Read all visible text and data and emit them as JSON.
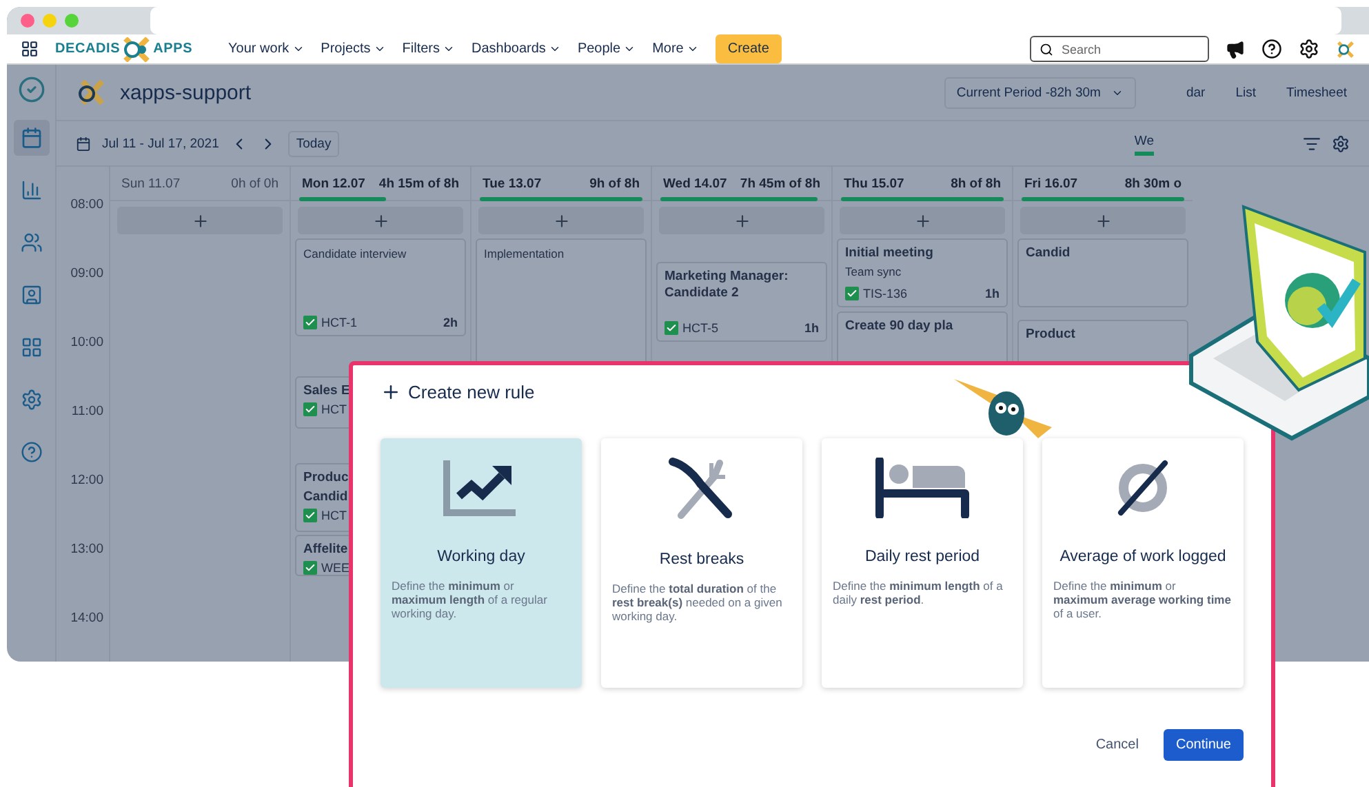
{
  "nav": {
    "items": [
      {
        "label": "Your work"
      },
      {
        "label": "Projects"
      },
      {
        "label": "Filters"
      },
      {
        "label": "Dashboards"
      },
      {
        "label": "People"
      },
      {
        "label": "More"
      }
    ],
    "logo_left": "DECADIS",
    "logo_right": "APPS",
    "create": "Create",
    "search": {
      "placeholder": "Search"
    }
  },
  "sidebar": {
    "items": [
      {
        "kind": "chart",
        "selected": false
      },
      {
        "kind": "team",
        "selected": false
      },
      {
        "kind": "user",
        "selected": false
      },
      {
        "kind": "grid",
        "selected": false
      },
      {
        "kind": "gear",
        "selected": false
      },
      {
        "kind": "help",
        "selected": false
      }
    ],
    "calendar_selected": true
  },
  "project": {
    "title": "xapps-support",
    "period": "Current Period -82h 30m",
    "views": [
      {
        "label": "dar"
      },
      {
        "label": "List"
      },
      {
        "label": "Timesheet"
      }
    ]
  },
  "toolbar": {
    "range": "Jul 11 - Jul 17, 2021",
    "today": "Today",
    "mode": "We"
  },
  "times": [
    "08:00",
    "09:00",
    "10:00",
    "11:00",
    "12:00",
    "13:00",
    "14:00"
  ],
  "days": [
    {
      "name": "Sun",
      "date": "11.07",
      "total": "0h of 0h"
    },
    {
      "name": "Mon",
      "date": "12.07",
      "total": "4h 15m of 8h",
      "level": 0.53,
      "events": [
        {
          "kind": "note",
          "title": "Candidate interview",
          "issue": "HCT-1",
          "time": "2h"
        },
        {
          "kind": "task",
          "title": "Sales E",
          "issue": "HCT"
        },
        {
          "kind": "task",
          "title": "Produc",
          "title2": "Candid",
          "issue": "HCT"
        },
        {
          "kind": "task",
          "title": "Affelite",
          "issue": "WEE"
        }
      ]
    },
    {
      "name": "Tue",
      "date": "13.07",
      "total": "9h of 8h",
      "level": 1,
      "events": [
        {
          "kind": "note",
          "title": "Implementation"
        }
      ]
    },
    {
      "name": "Wed",
      "date": "14.07",
      "total": "7h 45m of 8h",
      "level": 0.97,
      "events": [
        {
          "kind": "task",
          "title": "Marketing Manager: Candidate 2",
          "issue": "HCT-5",
          "time": "1h"
        }
      ]
    },
    {
      "name": "Thu",
      "date": "15.07",
      "total": "8h of 8h",
      "level": 1,
      "events": [
        {
          "kind": "task",
          "title": "Initial meeting",
          "subtitle": "Team sync",
          "issue": "TIS-136",
          "time": "1h"
        },
        {
          "kind": "task",
          "title": "Create 90 day pla"
        }
      ]
    },
    {
      "name": "Fri",
      "date": "16.07",
      "total": "8h 30m o",
      "level": 1,
      "events": [
        {
          "kind": "task",
          "title": "Candid"
        },
        {
          "kind": "task",
          "title": "Product"
        }
      ]
    }
  ],
  "modal": {
    "title": "Create new rule",
    "cards": [
      {
        "kind": "chart",
        "title": "Working day",
        "text": "Define the **minimum** or **maximum length** of a regular working day.",
        "selected": true
      },
      {
        "kind": "cutlery",
        "title": "Rest breaks",
        "text": "Define the **total duration** of the **rest break(s)** needed on a given working day.",
        "selected": false
      },
      {
        "kind": "bed",
        "title": "Daily rest period",
        "text": "Define the **minimum length** of a daily **rest period**.",
        "selected": false
      },
      {
        "kind": "empty",
        "title": "Average of work logged",
        "text": "Define the **minimum** or **maximum average working time** of a user.",
        "selected": false
      }
    ],
    "cancel": "Cancel",
    "continue": "Continue"
  }
}
